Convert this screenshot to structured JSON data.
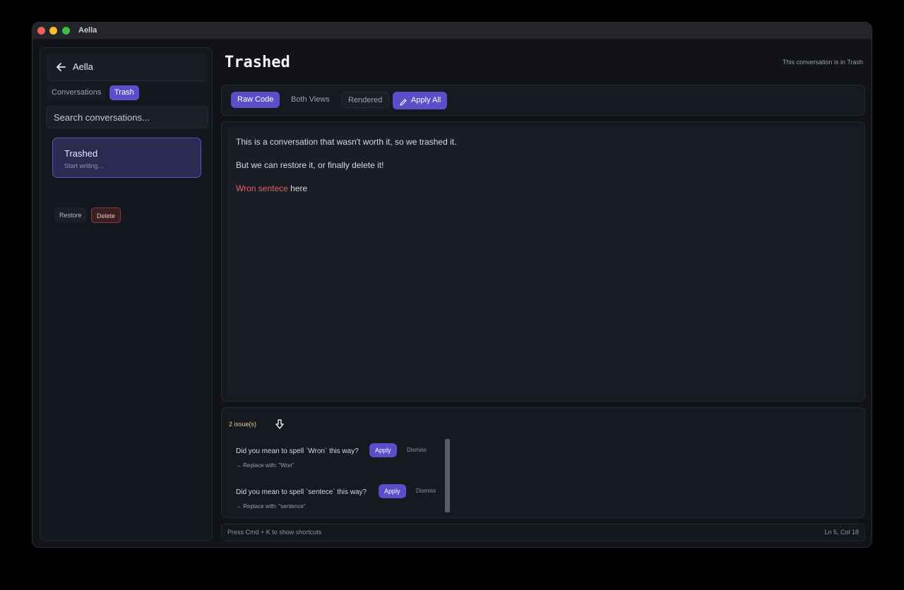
{
  "window": {
    "title": "Aella"
  },
  "sidebar": {
    "app_name": "Aella",
    "tabs": [
      {
        "label": "Conversations",
        "active": false
      },
      {
        "label": "Trash",
        "active": true
      }
    ],
    "search": {
      "placeholder": "Search conversations..."
    },
    "conversations": [
      {
        "title": "Trashed",
        "subtitle": "Start writing..."
      }
    ],
    "actions": {
      "restore": "Restore",
      "delete": "Delete"
    }
  },
  "main": {
    "title": "Trashed",
    "status_note": "This conversation is in Trash",
    "toolbar": {
      "raw_code": "Raw Code",
      "both_views": "Both Views",
      "rendered": "Rendered",
      "apply_all": "Apply All"
    },
    "editor": {
      "line1": "This is a conversation that wasn't worth it, so we trashed it.",
      "line2": "But we can restore it, or finally delete it!",
      "line3_error": "Wron sentece",
      "line3_rest": " here"
    },
    "issues": {
      "count": "2 issue(s)",
      "items": [
        {
          "question": "Did you mean to spell `Wron` this way?",
          "replacement": "→ Replace with: \"Won\"",
          "apply": "Apply",
          "dismiss": "Dismiss"
        },
        {
          "question": "Did you mean to spell `sentece` this way?",
          "replacement": "→ Replace with: \"sentence\"",
          "apply": "Apply",
          "dismiss": "Dismiss"
        }
      ]
    },
    "statusbar": {
      "hint": "Press Cmd + K to show shortcuts",
      "position": "Ln 5, Col 18"
    }
  },
  "colors": {
    "accent": "#5b4fc9",
    "error": "#e0615c",
    "background": "#111318"
  }
}
